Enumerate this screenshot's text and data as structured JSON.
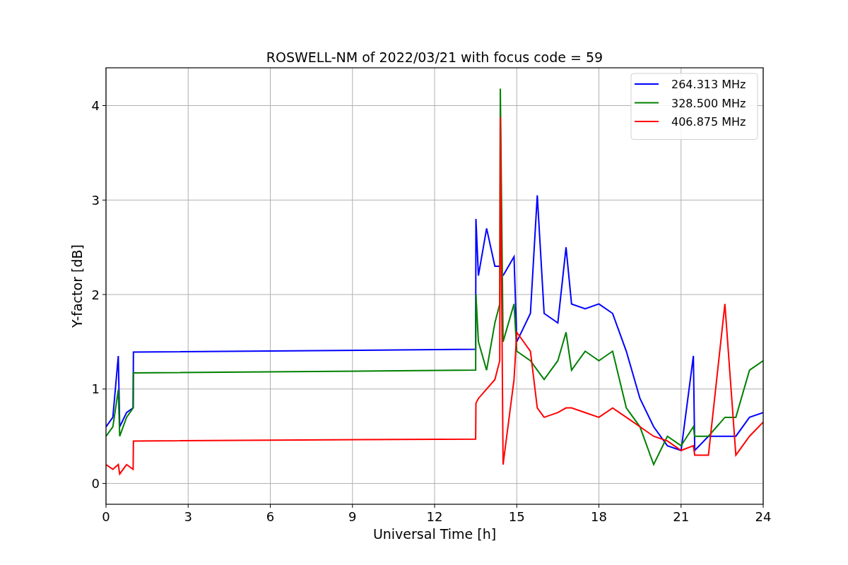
{
  "figure": {
    "chart_data": {
      "type": "line",
      "title": "ROSWELL-NM of 2022/03/21 with focus code = 59",
      "xlabel": "Universal Time [h]",
      "ylabel": "Y-factor [dB]",
      "x": [
        0,
        0.25,
        0.45,
        0.5,
        0.75,
        0.99,
        1.0,
        13.5,
        13.51,
        13.6,
        13.9,
        14.2,
        14.38,
        14.4,
        14.5,
        14.9,
        15.0,
        15.5,
        15.75,
        16,
        16.5,
        16.8,
        17,
        17.5,
        18,
        18.5,
        19,
        19.5,
        20,
        20.5,
        21,
        21.45,
        21.5,
        22,
        22.6,
        23,
        23.5,
        24
      ],
      "series": [
        {
          "name": "264.313 MHz",
          "color": "#0000ff",
          "values": [
            0.6,
            0.7,
            1.35,
            0.6,
            0.75,
            0.8,
            1.39,
            1.42,
            2.8,
            2.2,
            2.7,
            2.3,
            2.3,
            null,
            2.2,
            2.4,
            1.5,
            1.8,
            3.05,
            1.8,
            1.7,
            2.5,
            1.9,
            1.85,
            1.9,
            1.8,
            1.4,
            0.9,
            0.6,
            0.4,
            0.35,
            1.35,
            0.35,
            0.5,
            0.5,
            0.5,
            0.7,
            0.75
          ]
        },
        {
          "name": "328.500 MHz",
          "color": "#008000",
          "values": [
            0.5,
            0.6,
            0.99,
            0.5,
            0.7,
            0.8,
            1.17,
            1.2,
            2.0,
            1.5,
            1.2,
            1.7,
            1.9,
            4.18,
            1.5,
            1.9,
            1.4,
            1.3,
            1.2,
            1.1,
            1.3,
            1.6,
            1.2,
            1.4,
            1.3,
            1.4,
            0.8,
            0.6,
            0.2,
            0.5,
            0.4,
            0.6,
            0.5,
            0.5,
            0.7,
            0.7,
            1.2,
            1.3
          ]
        },
        {
          "name": "406.875 MHz",
          "color": "#ff0000",
          "values": [
            0.2,
            0.15,
            0.2,
            0.1,
            0.2,
            0.15,
            0.45,
            0.47,
            0.85,
            0.9,
            1.0,
            1.1,
            1.3,
            3.88,
            0.2,
            1.1,
            1.6,
            1.4,
            0.8,
            0.7,
            0.75,
            0.8,
            0.8,
            0.75,
            0.7,
            0.8,
            0.7,
            0.6,
            0.5,
            0.45,
            0.35,
            0.4,
            0.3,
            0.3,
            1.9,
            0.3,
            0.5,
            0.65
          ]
        }
      ],
      "xlim": [
        0,
        24
      ],
      "ylim": [
        -0.22,
        4.4
      ],
      "xticks": [
        0,
        3,
        6,
        9,
        12,
        15,
        18,
        21,
        24
      ],
      "yticks": [
        0,
        1,
        2,
        3,
        4
      ],
      "grid": true,
      "legend": true
    }
  }
}
